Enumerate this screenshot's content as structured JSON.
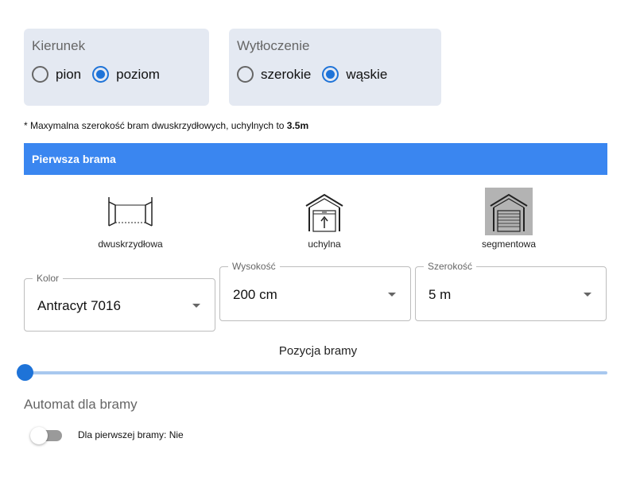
{
  "direction": {
    "title": "Kierunek",
    "options": [
      {
        "label": "pion",
        "checked": false
      },
      {
        "label": "poziom",
        "checked": true
      }
    ]
  },
  "embossing": {
    "title": "Wytłoczenie",
    "options": [
      {
        "label": "szerokie",
        "checked": false
      },
      {
        "label": "wąskie",
        "checked": true
      }
    ]
  },
  "note": {
    "text": "* Maxymalna szerokość bram dwuskrzydłowych, uchylnych to ",
    "value": "3.5m"
  },
  "section": {
    "title": "Pierwsza brama"
  },
  "gate_types": [
    {
      "label": "dwuskrzydłowa",
      "icon": "double-wing-gate-icon",
      "selected": false
    },
    {
      "label": "uchylna",
      "icon": "tilt-gate-icon",
      "selected": false
    },
    {
      "label": "segmentowa",
      "icon": "sectional-gate-icon",
      "selected": true
    }
  ],
  "color_select": {
    "legend": "Kolor",
    "value": "Antracyt 7016"
  },
  "height_select": {
    "legend": "Wysokość",
    "value": "200 cm"
  },
  "width_select": {
    "legend": "Szerokość",
    "value": "5 m"
  },
  "position_slider": {
    "title": "Pozycja bramy",
    "value": 0
  },
  "automation": {
    "title": "Automat dla bramy",
    "toggle_label": "Dla pierwszej bramy: Nie",
    "enabled": false
  },
  "colors": {
    "accent": "#1e73d8",
    "section_bar": "#3a86f0",
    "panel": "#e4e9f2"
  }
}
